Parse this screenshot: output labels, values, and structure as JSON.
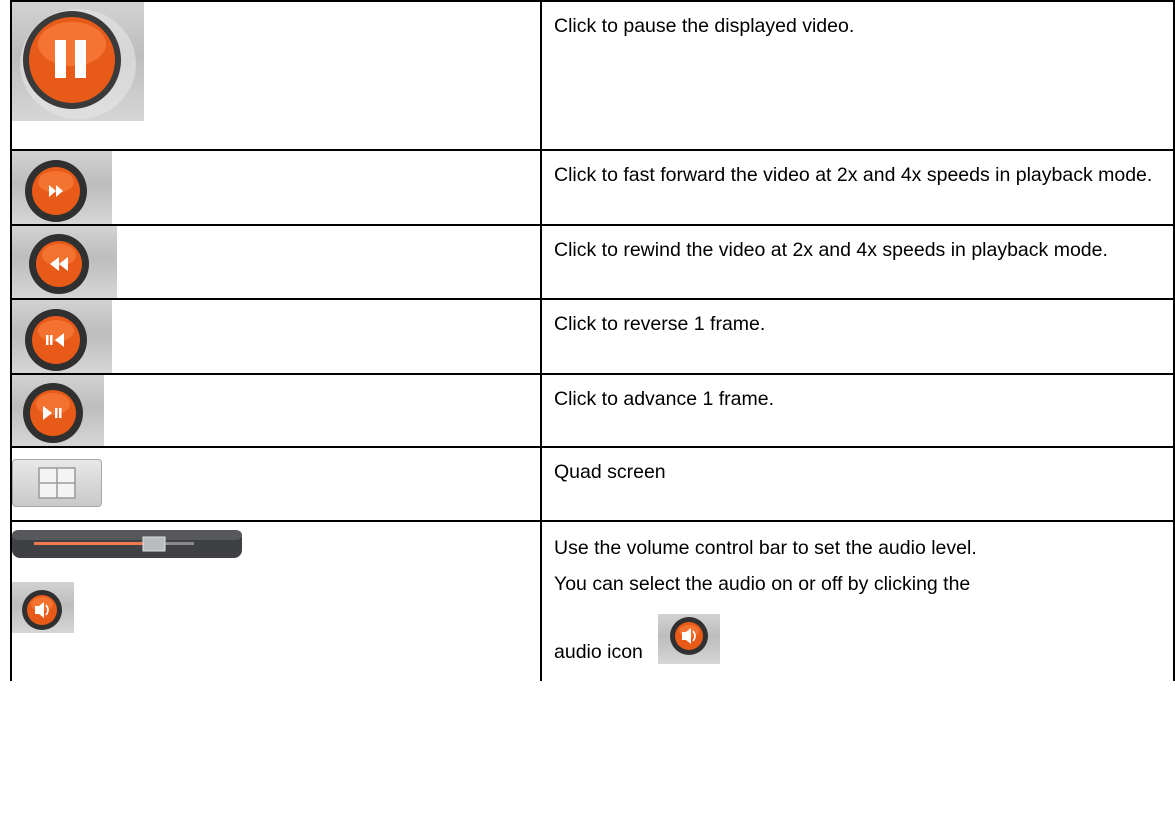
{
  "rows": [
    {
      "icon": "pause-button-icon",
      "text": "Click to pause the displayed video."
    },
    {
      "icon": "fast-forward-button-icon",
      "text": "Click to fast forward the video at 2x and 4x speeds in playback mode."
    },
    {
      "icon": "rewind-button-icon",
      "text": "Click to rewind the video at 2x  and 4x speeds in playback mode."
    },
    {
      "icon": "reverse-frame-button-icon",
      "text": "Click to reverse 1 frame."
    },
    {
      "icon": "advance-frame-button-icon",
      "text": "Click to advance 1 frame."
    },
    {
      "icon": "quad-screen-button-icon",
      "text": "Quad screen"
    }
  ],
  "volume_row": {
    "line1": "Use the volume control bar to set the audio level.",
    "line2": "You can select the audio on or off by clicking the",
    "line3": "audio icon",
    "volume_level": 0.75
  },
  "colors": {
    "button_orange": "#f0641e",
    "button_ring": "#2b2b2b",
    "tile_gray": "#c8c8c8"
  }
}
